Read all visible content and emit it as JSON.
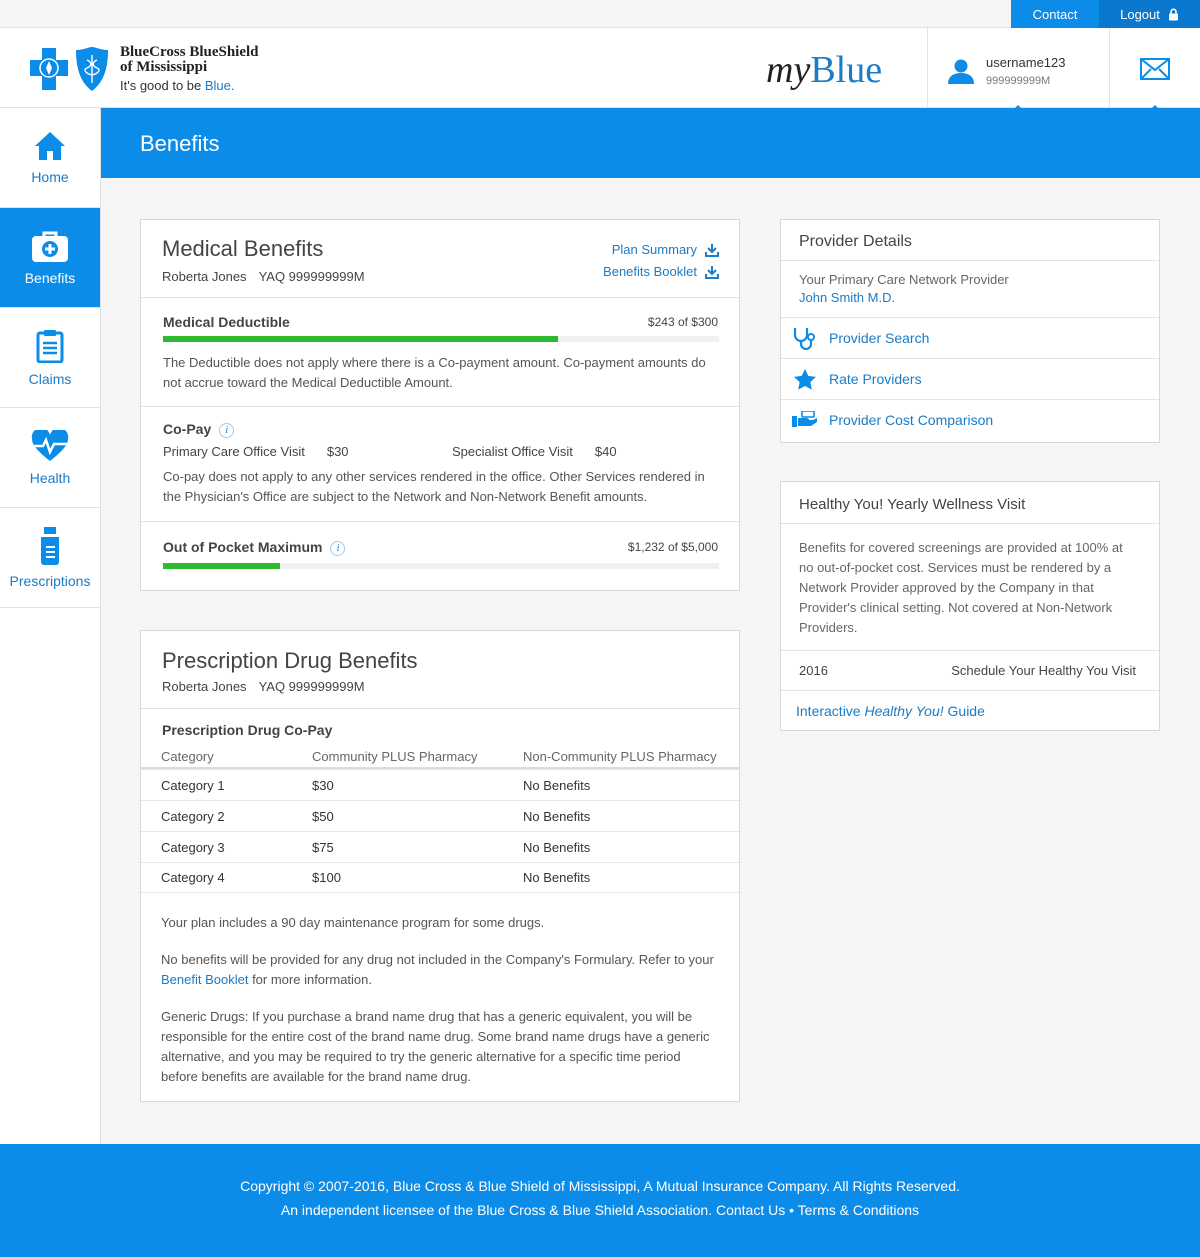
{
  "utility": {
    "contact": "Contact",
    "logout": "Logout"
  },
  "header": {
    "logo_line1": "BlueCross BlueShield",
    "logo_line2": "of Mississippi",
    "tagline_prefix": "It's good to be ",
    "tagline_blue": "Blue.",
    "brand_my": "my",
    "brand_blue": "Blue",
    "username": "username123",
    "member_id": "999999999M"
  },
  "sidebar": {
    "items": [
      {
        "label": "Home",
        "icon": "home-icon"
      },
      {
        "label": "Benefits",
        "icon": "medical-bag-icon"
      },
      {
        "label": "Claims",
        "icon": "clipboard-icon"
      },
      {
        "label": "Health",
        "icon": "heart-pulse-icon"
      },
      {
        "label": "Prescriptions",
        "icon": "pill-bottle-icon"
      }
    ]
  },
  "page": {
    "title": "Benefits"
  },
  "medical": {
    "title": "Medical Benefits",
    "member_name": "Roberta Jones",
    "member_id": "YAQ 999999999M",
    "plan_summary": "Plan Summary",
    "benefits_booklet": "Benefits Booklet",
    "deductible": {
      "label": "Medical Deductible",
      "value": "$243 of $300",
      "progress": 0.71,
      "note": "The Deductible does not apply where there is a Co-payment amount. Co-payment amounts do not accrue toward the Medical Deductible Amount."
    },
    "copay": {
      "label": "Co-Pay",
      "pcp_label": "Primary Care Office Visit",
      "pcp_value": "$30",
      "spec_label": "Specialist Office Visit",
      "spec_value": "$40",
      "note": "Co-pay does not apply to any other services rendered in the office. Other Services rendered in the Physician's Office are subject to the Network and Non-Network Benefit amounts."
    },
    "oop": {
      "label": "Out of Pocket Maximum",
      "value": "$1,232 of $5,000",
      "progress": 0.21
    }
  },
  "rx": {
    "title": "Prescription Drug Benefits",
    "member_name": "Roberta Jones",
    "member_id": "YAQ 999999999M",
    "table_title": "Prescription Drug Co-Pay",
    "columns": [
      "Category",
      "Community PLUS Pharmacy",
      "Non-Community PLUS Pharmacy"
    ],
    "rows": [
      [
        "Category 1",
        "$30",
        "No Benefits"
      ],
      [
        "Category 2",
        "$50",
        "No Benefits"
      ],
      [
        "Category 3",
        "$75",
        "No Benefits"
      ],
      [
        "Category 4",
        "$100",
        "No Benefits"
      ]
    ],
    "note1": "Your plan includes a 90 day maintenance program for some drugs.",
    "note2_pre": "No benefits will be provided for any drug not included in the Company's Formulary. Refer to your ",
    "note2_link": "Benefit Booklet",
    "note2_post": " for more information.",
    "note3": "Generic Drugs: If you purchase a brand name drug that has a generic equivalent, you will be responsible for the entire cost of the brand name drug. Some brand name drugs have a generic alternative, and you may be required to try the generic alternative for a specific time period before benefits are available for the brand name drug."
  },
  "provider": {
    "title": "Provider Details",
    "pcp_label": "Your Primary Care Network Provider",
    "pcp_name": "John Smith M.D.",
    "links": [
      {
        "label": "Provider Search",
        "icon": "stethoscope-icon"
      },
      {
        "label": "Rate Providers",
        "icon": "star-icon"
      },
      {
        "label": "Provider Cost Comparison",
        "icon": "hand-money-icon"
      }
    ]
  },
  "wellness": {
    "title": "Healthy You! Yearly Wellness Visit",
    "body": "Benefits for covered screenings are provided at 100% at no out-of-pocket cost. Services must be rendered by a Network Provider approved by the Company in that Provider's clinical setting. Not covered at Non-Network Providers.",
    "year": "2016",
    "schedule": "Schedule Your Healthy You Visit",
    "guide_pre": "Interactive ",
    "guide_em": "Healthy You!",
    "guide_post": " Guide"
  },
  "footer": {
    "line1": "Copyright © 2007-2016, Blue Cross & Blue Shield of Mississippi, A Mutual Insurance Company. All Rights Reserved.",
    "line2_pre": "An independent licensee of the Blue Cross & Blue Shield Association. ",
    "contact": "Contact Us",
    "bullet": " • ",
    "terms": "Terms & Conditions"
  },
  "colors": {
    "primary": "#0c8ce9",
    "link": "#1a7bc6",
    "progress": "#2eb82e"
  }
}
